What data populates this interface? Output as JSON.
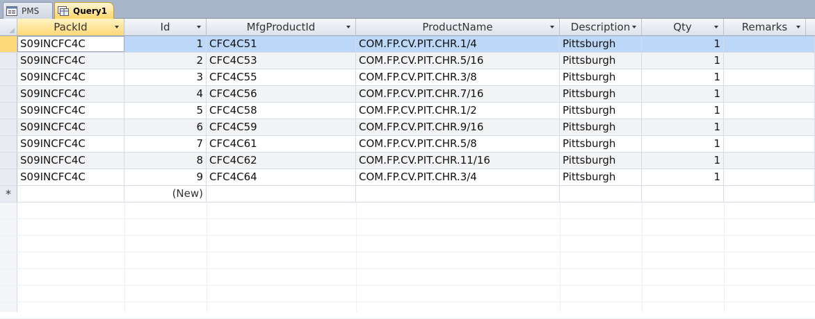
{
  "tabs": [
    {
      "label": "PMS",
      "icon": "form-icon",
      "active": false
    },
    {
      "label": "Query1",
      "icon": "query-icon",
      "active": true
    }
  ],
  "columns": [
    {
      "label": "PackId"
    },
    {
      "label": "Id"
    },
    {
      "label": "MfgProductId"
    },
    {
      "label": "ProductName"
    },
    {
      "label": "Description"
    },
    {
      "label": "Qty"
    },
    {
      "label": "Remarks"
    }
  ],
  "rows": [
    {
      "packid": "S09INCFC4C",
      "id": "1",
      "mfg": "CFC4C51",
      "name": "COM.FP.CV.PIT.CHR.1/4",
      "desc": "Pittsburgh",
      "qty": "1",
      "remarks": ""
    },
    {
      "packid": "S09INCFC4C",
      "id": "2",
      "mfg": "CFC4C53",
      "name": "COM.FP.CV.PIT.CHR.5/16",
      "desc": "Pittsburgh",
      "qty": "1",
      "remarks": ""
    },
    {
      "packid": "S09INCFC4C",
      "id": "3",
      "mfg": "CFC4C55",
      "name": "COM.FP.CV.PIT.CHR.3/8",
      "desc": "Pittsburgh",
      "qty": "1",
      "remarks": ""
    },
    {
      "packid": "S09INCFC4C",
      "id": "4",
      "mfg": "CFC4C56",
      "name": "COM.FP.CV.PIT.CHR.7/16",
      "desc": "Pittsburgh",
      "qty": "1",
      "remarks": ""
    },
    {
      "packid": "S09INCFC4C",
      "id": "5",
      "mfg": "CFC4C58",
      "name": "COM.FP.CV.PIT.CHR.1/2",
      "desc": "Pittsburgh",
      "qty": "1",
      "remarks": ""
    },
    {
      "packid": "S09INCFC4C",
      "id": "6",
      "mfg": "CFC4C59",
      "name": "COM.FP.CV.PIT.CHR.9/16",
      "desc": "Pittsburgh",
      "qty": "1",
      "remarks": ""
    },
    {
      "packid": "S09INCFC4C",
      "id": "7",
      "mfg": "CFC4C61",
      "name": "COM.FP.CV.PIT.CHR.5/8",
      "desc": "Pittsburgh",
      "qty": "1",
      "remarks": ""
    },
    {
      "packid": "S09INCFC4C",
      "id": "8",
      "mfg": "CFC4C62",
      "name": "COM.FP.CV.PIT.CHR.11/16",
      "desc": "Pittsburgh",
      "qty": "1",
      "remarks": ""
    },
    {
      "packid": "S09INCFC4C",
      "id": "9",
      "mfg": "CFC4C64",
      "name": "COM.FP.CV.PIT.CHR.3/4",
      "desc": "Pittsburgh",
      "qty": "1",
      "remarks": ""
    }
  ],
  "new_row": {
    "marker": "*",
    "id_placeholder": "(New)"
  },
  "colors": {
    "selected_row": "#bcd7f7",
    "active_tab": "#ffd66b",
    "tabstrip": "#a9b5c8"
  }
}
